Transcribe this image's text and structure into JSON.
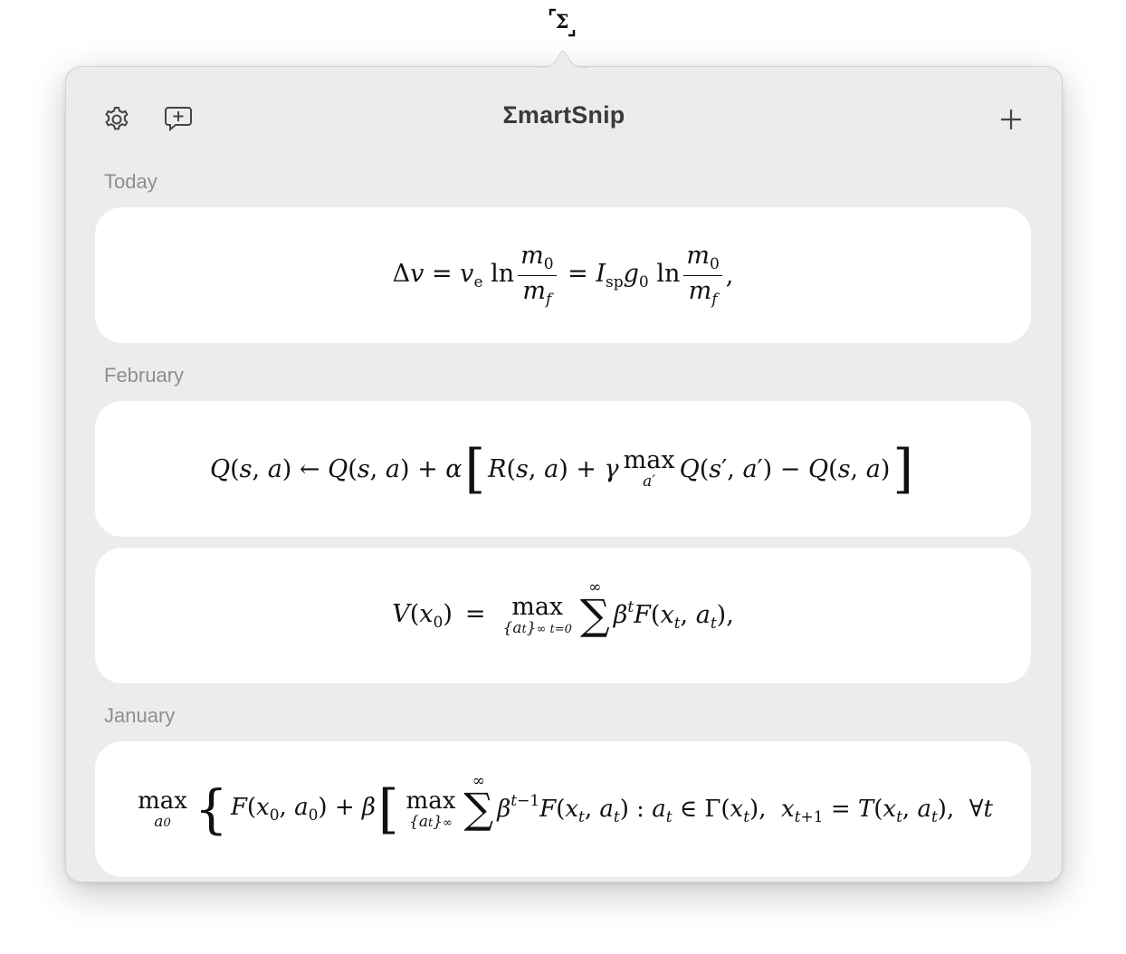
{
  "menubar": {
    "icon_name": "smartsnip-menubar-icon",
    "symbol": "Σ"
  },
  "toolbar": {
    "title": "ΣmartSnip",
    "settings_icon": "gear-icon",
    "feedback_icon": "message-plus-icon",
    "add_icon": "plus-icon"
  },
  "sections": [
    {
      "label": "Today"
    },
    {
      "label": "February"
    },
    {
      "label": "January"
    }
  ],
  "snips": [
    {
      "section": "Today",
      "latex": "\\Delta v = v_{\\text{e}} \\ln \\frac{m_0}{m_f} = I_{\\text{sp}} g_0 \\ln \\frac{m_0}{m_f},"
    },
    {
      "section": "February",
      "latex": "Q(s,a) \\leftarrow Q(s,a) + \\alpha \\left[R(s,a) + \\gamma \\max_{a'} Q(s',a') - Q(s,a)\\right]"
    },
    {
      "section": "February",
      "latex": "V(x_0) \\; = \\; \\max_{\\{a_t\\}_{t=0}^{\\infty}} \\sum^{\\infty} \\beta^t F(x_t,a_t),"
    },
    {
      "section": "January",
      "latex": "\\max_{a_0} \\left\\{ F(x_0,a_0) + \\beta \\left[ \\max_{\\{a_t\\}^{\\infty}} \\sum^{\\infty} \\beta^{t-1} F(x_t,a_t) : a_t \\in \\Gamma(x_t),\\; x_{t+1} = T(x_t,a_t),\\; \\forall t"
    }
  ],
  "colors": {
    "popover_bg": "#ececec",
    "card_bg": "#ffffff",
    "section_label": "#8e8e8e",
    "title": "#3a3a3a"
  }
}
